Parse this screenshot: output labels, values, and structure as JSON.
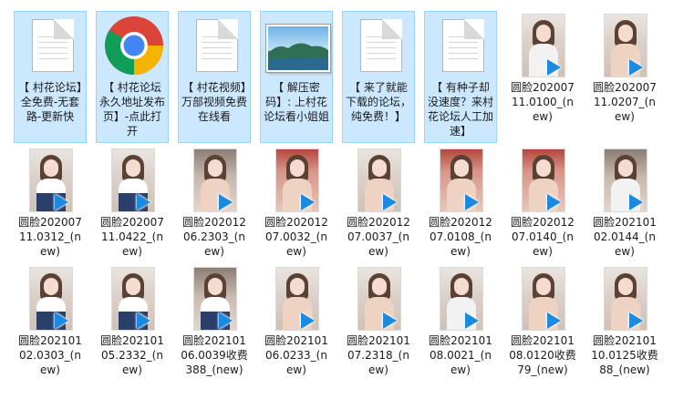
{
  "files": [
    {
      "name": "【 村花论坛】全免费-无套路-更新快",
      "icon": "document-icon",
      "selected": true
    },
    {
      "name": "【 村花论坛永久地址发布页】-点此打开",
      "icon": "chrome-icon",
      "selected": true
    },
    {
      "name": "【 村花视频】万部视频免费在线看",
      "icon": "document-icon",
      "selected": true
    },
    {
      "name": "【 解压密码】: 上村花论坛看小姐姐",
      "icon": "image-icon",
      "selected": true
    },
    {
      "name": "【 来了就能下载的论坛，纯免费！】",
      "icon": "document-icon",
      "selected": true
    },
    {
      "name": "【 有种子却没速度？来村花论坛人工加速】",
      "icon": "document-icon",
      "selected": true
    },
    {
      "name": "圆脸20200711.0100_(new)",
      "icon": "video-icon",
      "selected": false
    },
    {
      "name": "圆脸20200711.0207_(new)",
      "icon": "video-icon",
      "selected": false
    },
    {
      "name": "圆脸20200711.0312_(new)",
      "icon": "video-icon",
      "selected": false
    },
    {
      "name": "圆脸20200711.0422_(new)",
      "icon": "video-icon",
      "selected": false
    },
    {
      "name": "圆脸20201206.2303_(new)",
      "icon": "video-icon",
      "selected": false
    },
    {
      "name": "圆脸20201207.0032_(new)",
      "icon": "video-icon",
      "selected": false
    },
    {
      "name": "圆脸20201207.0037_(new)",
      "icon": "video-icon",
      "selected": false
    },
    {
      "name": "圆脸20201207.0108_(new)",
      "icon": "video-icon",
      "selected": false
    },
    {
      "name": "圆脸20201207.0140_(new)",
      "icon": "video-icon",
      "selected": false
    },
    {
      "name": "圆脸20210102.0144_(new)",
      "icon": "video-icon",
      "selected": false
    },
    {
      "name": "圆脸20210102.0303_(new)",
      "icon": "video-icon",
      "selected": false
    },
    {
      "name": "圆脸20210105.2332_(new)",
      "icon": "video-icon",
      "selected": false
    },
    {
      "name": "圆脸20210106.0039收费388_(new)",
      "icon": "video-icon",
      "selected": false
    },
    {
      "name": "圆脸20210106.0233_(new)",
      "icon": "video-icon",
      "selected": false
    },
    {
      "name": "圆脸20210107.2318_(new)",
      "icon": "video-icon",
      "selected": false
    },
    {
      "name": "圆脸20210108.0021_(new)",
      "icon": "video-icon",
      "selected": false
    },
    {
      "name": "圆脸20210108.0120收费79_(new)",
      "icon": "video-icon",
      "selected": false
    },
    {
      "name": "圆脸20210110.0125收费88_(new)",
      "icon": "video-icon",
      "selected": false
    }
  ],
  "colors": {
    "selection_bg": "#cce8ff",
    "selection_border": "#99d1ff",
    "play_icon": "#1a8be0"
  }
}
